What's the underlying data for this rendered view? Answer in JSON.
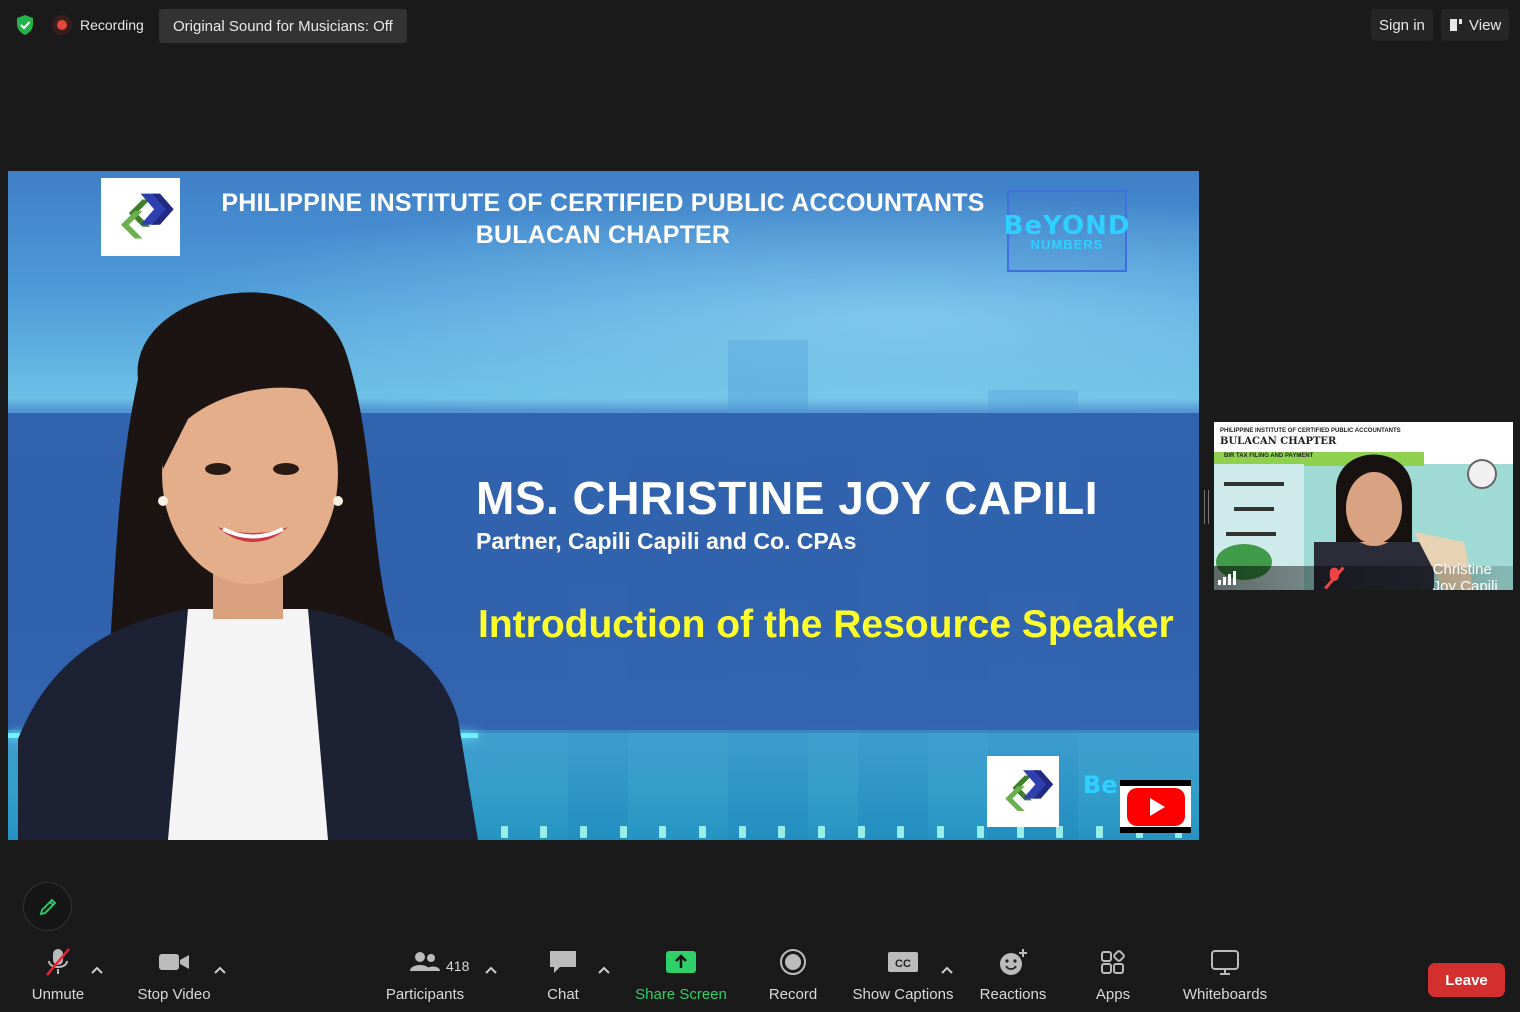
{
  "topbar": {
    "recording_label": "Recording",
    "sound_button": "Original Sound for Musicians: Off",
    "sign_in": "Sign in",
    "view": "View"
  },
  "slide": {
    "header_line1": "PHILIPPINE INSTITUTE OF CERTIFIED PUBLIC ACCOUNTANTS",
    "header_line2": "BULACAN CHAPTER",
    "beyond_top": "BeYOND",
    "beyond_bottom": "NUMBERS",
    "speaker_name": "MS. CHRISTINE JOY CAPILI",
    "speaker_role": "Partner, Capili Capili and Co. CPAs",
    "intro": "Introduction of the Resource Speaker",
    "small_beyond": "Be"
  },
  "thumbnail": {
    "header_line1": "PHILIPPINE INSTITUTE OF CERTIFIED PUBLIC ACCOUNTANTS",
    "header_line2": "BULACAN CHAPTER",
    "banner": "BIR TAX FILING AND PAYMENT",
    "participant_name": "Christine Joy Capili"
  },
  "toolbar": {
    "unmute": "Unmute",
    "stop_video": "Stop Video",
    "participants": "Participants",
    "participants_count": "418",
    "chat": "Chat",
    "share_screen": "Share Screen",
    "record": "Record",
    "show_captions": "Show Captions",
    "reactions": "Reactions",
    "apps": "Apps",
    "whiteboards": "Whiteboards",
    "leave": "Leave"
  },
  "colors": {
    "accent_green": "#2fd06a",
    "leave_red": "#d32f2f",
    "intro_yellow": "#ffff2a"
  }
}
